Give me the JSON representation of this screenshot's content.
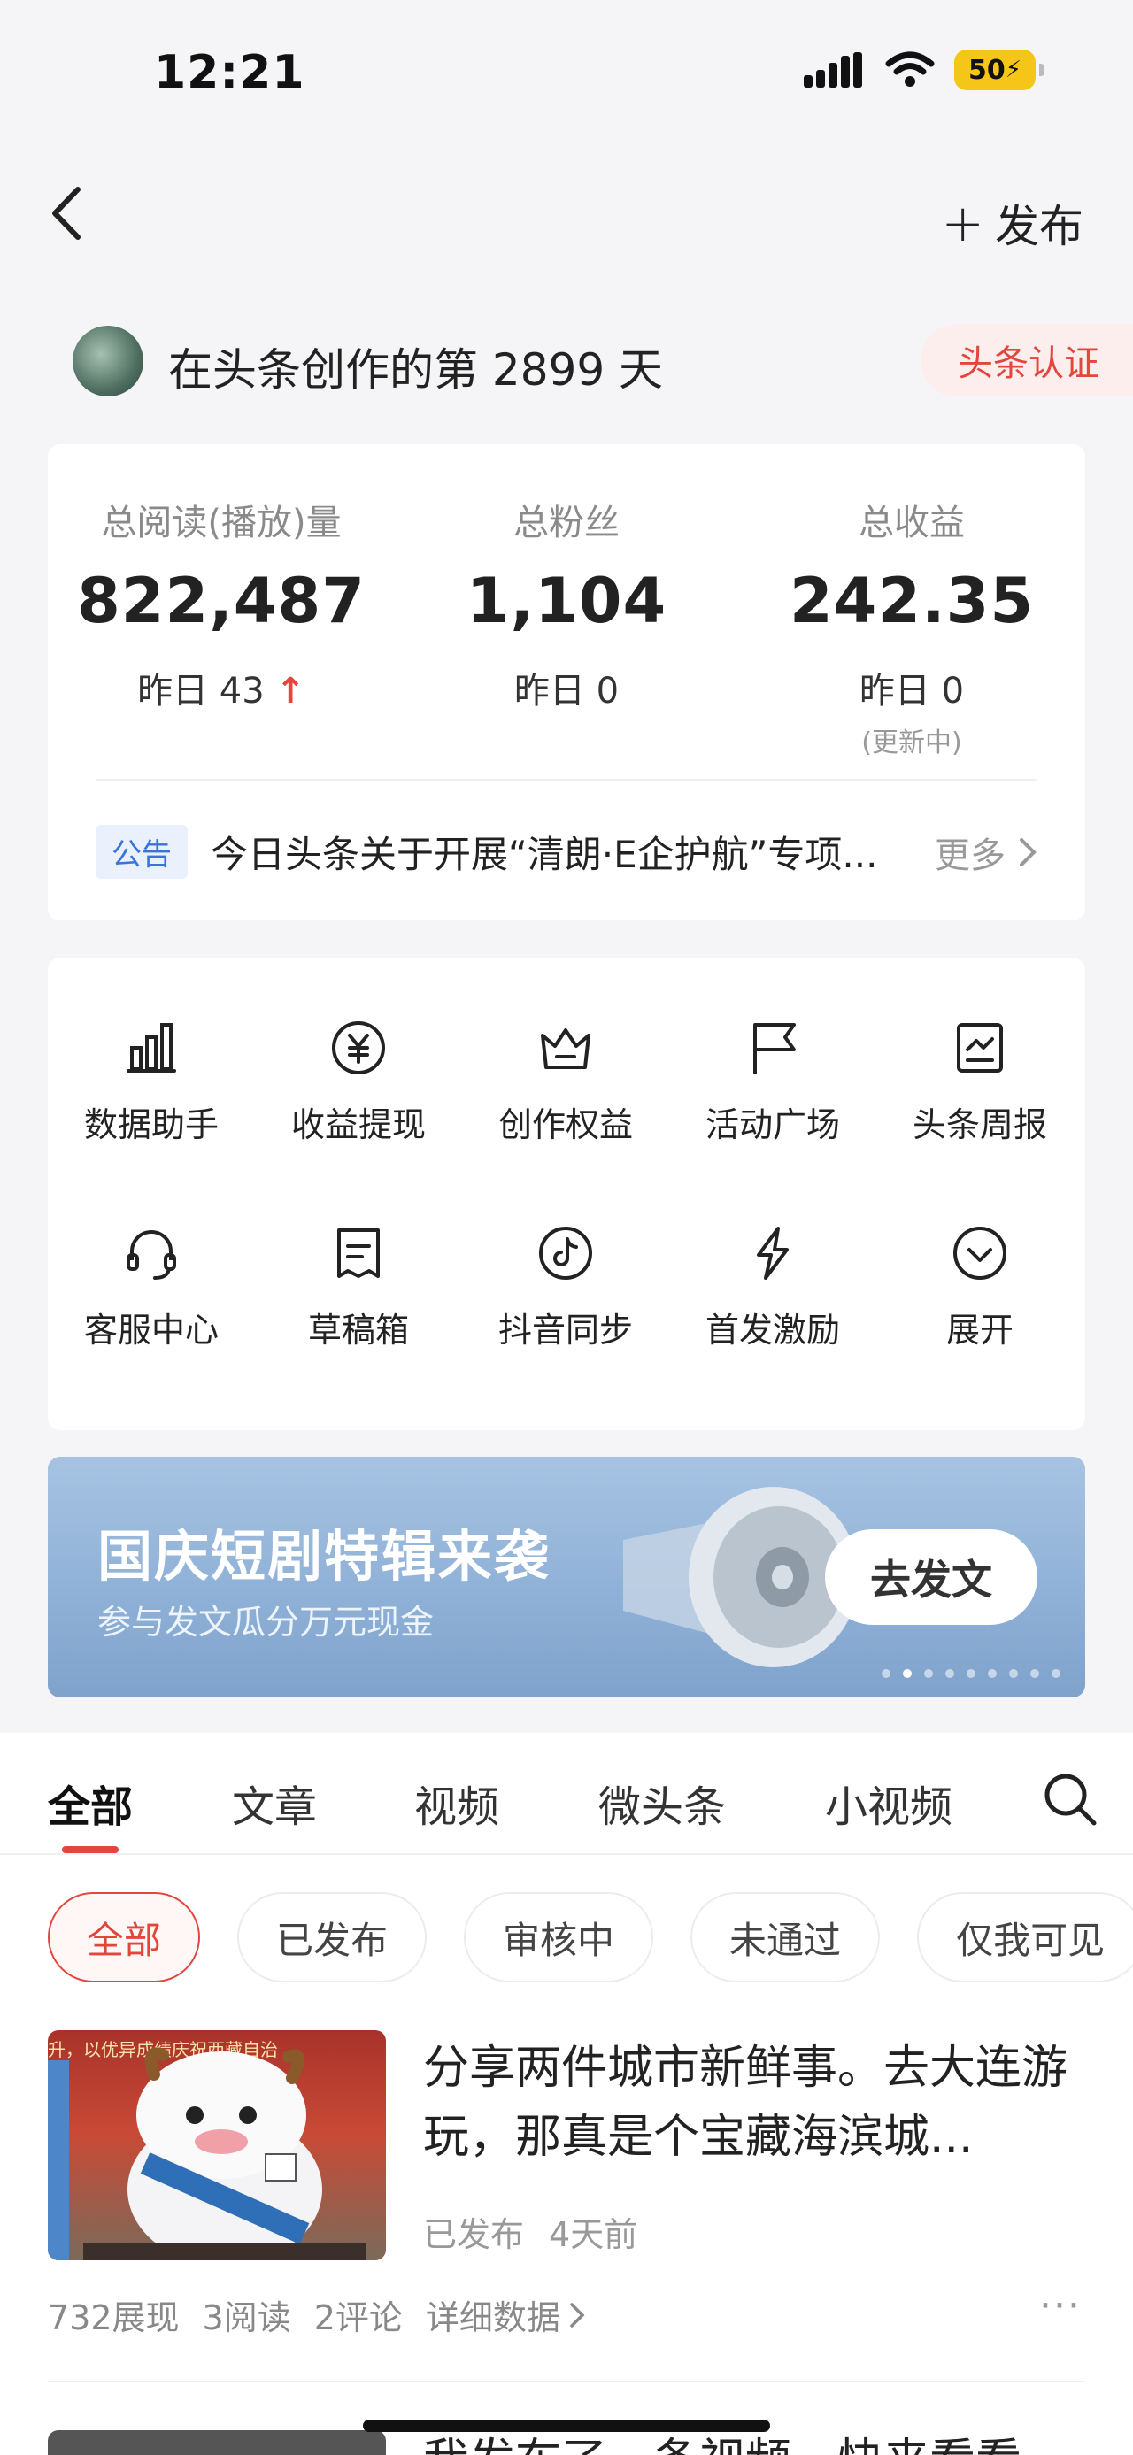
{
  "status_bar": {
    "time": "12:21",
    "battery": "50"
  },
  "nav": {
    "back_icon": "chevron-left-icon",
    "publish_label": "发布"
  },
  "creator": {
    "days_text": "在头条创作的第 2899 天",
    "verify_label": "头条认证"
  },
  "stats": {
    "items": [
      {
        "label": "总阅读(播放)量",
        "value": "822,487",
        "sub": "昨日 43"
      },
      {
        "label": "总粉丝",
        "value": "1,104",
        "sub": "昨日 0"
      },
      {
        "label": "总收益",
        "value": "242.35",
        "sub": "昨日 0",
        "note": "(更新中)"
      }
    ],
    "notice_tag": "公告",
    "notice_text": "今日头条关于开展“清朗·E企护航”专项...",
    "notice_more": "更多"
  },
  "tools": [
    {
      "label": "数据助手",
      "icon": "bar-chart-icon"
    },
    {
      "label": "收益提现",
      "icon": "yen-coin-icon"
    },
    {
      "label": "创作权益",
      "icon": "crown-icon"
    },
    {
      "label": "活动广场",
      "icon": "flag-icon"
    },
    {
      "label": "头条周报",
      "icon": "report-icon"
    },
    {
      "label": "客服中心",
      "icon": "headset-icon"
    },
    {
      "label": "草稿箱",
      "icon": "draft-icon"
    },
    {
      "label": "抖音同步",
      "icon": "douyin-icon"
    },
    {
      "label": "首发激励",
      "icon": "lightning-icon"
    },
    {
      "label": "展开",
      "icon": "expand-down-icon"
    }
  ],
  "banner": {
    "title": "国庆短剧特辑来袭",
    "subtitle": "参与发文瓜分万元现金",
    "button": "去发文",
    "page_count": 9,
    "active_page": 2
  },
  "content_tabs": [
    "全部",
    "文章",
    "视频",
    "微头条",
    "小视频"
  ],
  "filters": [
    "全部",
    "已发布",
    "审核中",
    "未通过",
    "仅我可见"
  ],
  "article": {
    "title": "分享两件城市新鲜事。去大连游玩，那真是个宝藏海滨城...",
    "status": "已发布",
    "time": "4天前",
    "impressions": "732展现",
    "reads": "3阅读",
    "comments": "2评论",
    "details": "详细数据",
    "thumb_banner_text": "升，以优异成绩庆祝西藏自治"
  },
  "article2": {
    "title": "我发布了一条视频，快来看看"
  }
}
